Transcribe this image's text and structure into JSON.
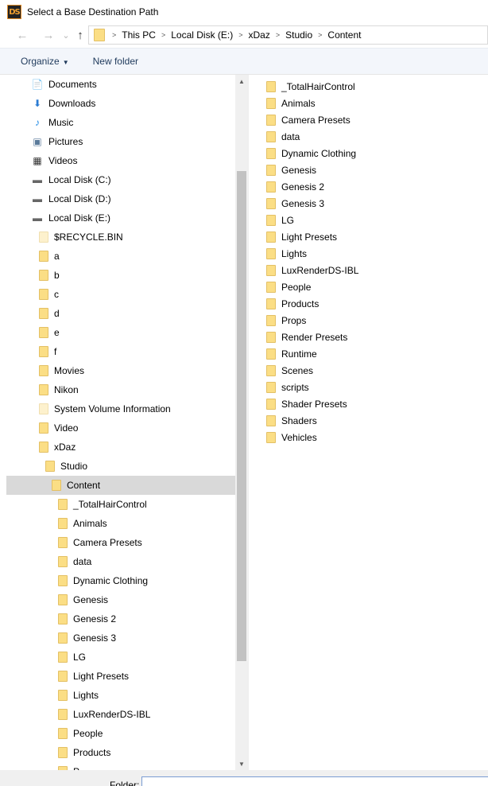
{
  "window": {
    "title": "Select a Base Destination Path",
    "app_icon_text": "DS"
  },
  "nav_buttons": {
    "back": "←",
    "forward": "→",
    "recent": "⌄",
    "up": "↑"
  },
  "address": {
    "crumbs": [
      "This PC",
      "Local Disk (E:)",
      "xDaz",
      "Studio",
      "Content"
    ]
  },
  "toolbar": {
    "organize_label": "Organize",
    "new_folder_label": "New folder"
  },
  "nav_tree": [
    {
      "label": "Documents",
      "icon": "documents-icon",
      "glyph": "📄",
      "indent": 0,
      "kind": "sys"
    },
    {
      "label": "Downloads",
      "icon": "downloads-icon",
      "glyph": "⬇",
      "indent": 0,
      "kind": "sys"
    },
    {
      "label": "Music",
      "icon": "music-icon",
      "glyph": "♪",
      "indent": 0,
      "kind": "sys"
    },
    {
      "label": "Pictures",
      "icon": "pictures-icon",
      "glyph": "▣",
      "indent": 0,
      "kind": "sys"
    },
    {
      "label": "Videos",
      "icon": "videos-icon",
      "glyph": "▦",
      "indent": 0,
      "kind": "sys"
    },
    {
      "label": "Local Disk (C:)",
      "icon": "drive-c-icon",
      "glyph": "▬",
      "indent": 0,
      "kind": "sys"
    },
    {
      "label": "Local Disk (D:)",
      "icon": "drive-d-icon",
      "glyph": "▬",
      "indent": 0,
      "kind": "sys"
    },
    {
      "label": "Local Disk (E:)",
      "icon": "drive-e-icon",
      "glyph": "▬",
      "indent": 0,
      "kind": "sys"
    },
    {
      "label": "$RECYCLE.BIN",
      "icon": "folder-icon",
      "indent": 1,
      "kind": "ghost"
    },
    {
      "label": "a",
      "icon": "folder-icon",
      "indent": 1,
      "kind": "folder"
    },
    {
      "label": "b",
      "icon": "folder-icon",
      "indent": 1,
      "kind": "folder"
    },
    {
      "label": "c",
      "icon": "folder-icon",
      "indent": 1,
      "kind": "folder"
    },
    {
      "label": "d",
      "icon": "folder-icon",
      "indent": 1,
      "kind": "folder"
    },
    {
      "label": "e",
      "icon": "folder-icon",
      "indent": 1,
      "kind": "folder"
    },
    {
      "label": "f",
      "icon": "folder-icon",
      "indent": 1,
      "kind": "folder"
    },
    {
      "label": "Movies",
      "icon": "folder-icon",
      "indent": 1,
      "kind": "folder"
    },
    {
      "label": "Nikon",
      "icon": "folder-icon",
      "indent": 1,
      "kind": "folder"
    },
    {
      "label": "System Volume Information",
      "icon": "folder-icon",
      "indent": 1,
      "kind": "ghost"
    },
    {
      "label": "Video",
      "icon": "folder-icon",
      "indent": 1,
      "kind": "folder"
    },
    {
      "label": "xDaz",
      "icon": "folder-icon",
      "indent": 1,
      "kind": "folder"
    },
    {
      "label": "Studio",
      "icon": "folder-icon",
      "indent": 2,
      "kind": "folder"
    },
    {
      "label": "Content",
      "icon": "folder-icon",
      "indent": 3,
      "kind": "folder",
      "selected": true
    },
    {
      "label": "_TotalHairControl",
      "icon": "folder-icon",
      "indent": 4,
      "kind": "folder"
    },
    {
      "label": "Animals",
      "icon": "folder-icon",
      "indent": 4,
      "kind": "folder"
    },
    {
      "label": "Camera Presets",
      "icon": "folder-icon",
      "indent": 4,
      "kind": "folder"
    },
    {
      "label": "data",
      "icon": "folder-icon",
      "indent": 4,
      "kind": "folder"
    },
    {
      "label": "Dynamic Clothing",
      "icon": "folder-icon",
      "indent": 4,
      "kind": "folder"
    },
    {
      "label": "Genesis",
      "icon": "folder-icon",
      "indent": 4,
      "kind": "folder"
    },
    {
      "label": "Genesis 2",
      "icon": "folder-icon",
      "indent": 4,
      "kind": "folder"
    },
    {
      "label": "Genesis 3",
      "icon": "folder-icon",
      "indent": 4,
      "kind": "folder"
    },
    {
      "label": "LG",
      "icon": "folder-icon",
      "indent": 4,
      "kind": "folder"
    },
    {
      "label": "Light Presets",
      "icon": "folder-icon",
      "indent": 4,
      "kind": "folder"
    },
    {
      "label": "Lights",
      "icon": "folder-icon",
      "indent": 4,
      "kind": "folder"
    },
    {
      "label": "LuxRenderDS-IBL",
      "icon": "folder-icon",
      "indent": 4,
      "kind": "folder"
    },
    {
      "label": "People",
      "icon": "folder-icon",
      "indent": 4,
      "kind": "folder"
    },
    {
      "label": "Products",
      "icon": "folder-icon",
      "indent": 4,
      "kind": "folder"
    },
    {
      "label": "P",
      "icon": "folder-icon",
      "indent": 4,
      "kind": "folder"
    }
  ],
  "content_items": [
    "_TotalHairControl",
    "Animals",
    "Camera Presets",
    "data",
    "Dynamic Clothing",
    "Genesis",
    "Genesis 2",
    "Genesis 3",
    "LG",
    "Light Presets",
    "Lights",
    "LuxRenderDS-IBL",
    "People",
    "Products",
    "Props",
    "Render Presets",
    "Runtime",
    "Scenes",
    "scripts",
    "Shader Presets",
    "Shaders",
    "Vehicles"
  ],
  "bottom": {
    "folder_label": "Folder:",
    "folder_value": ""
  },
  "colors": {
    "folder_fill": "#fbde85",
    "selection": "#d9d9d9",
    "toolbar_bg": "#f3f6fb",
    "link_text": "#1e395b"
  }
}
